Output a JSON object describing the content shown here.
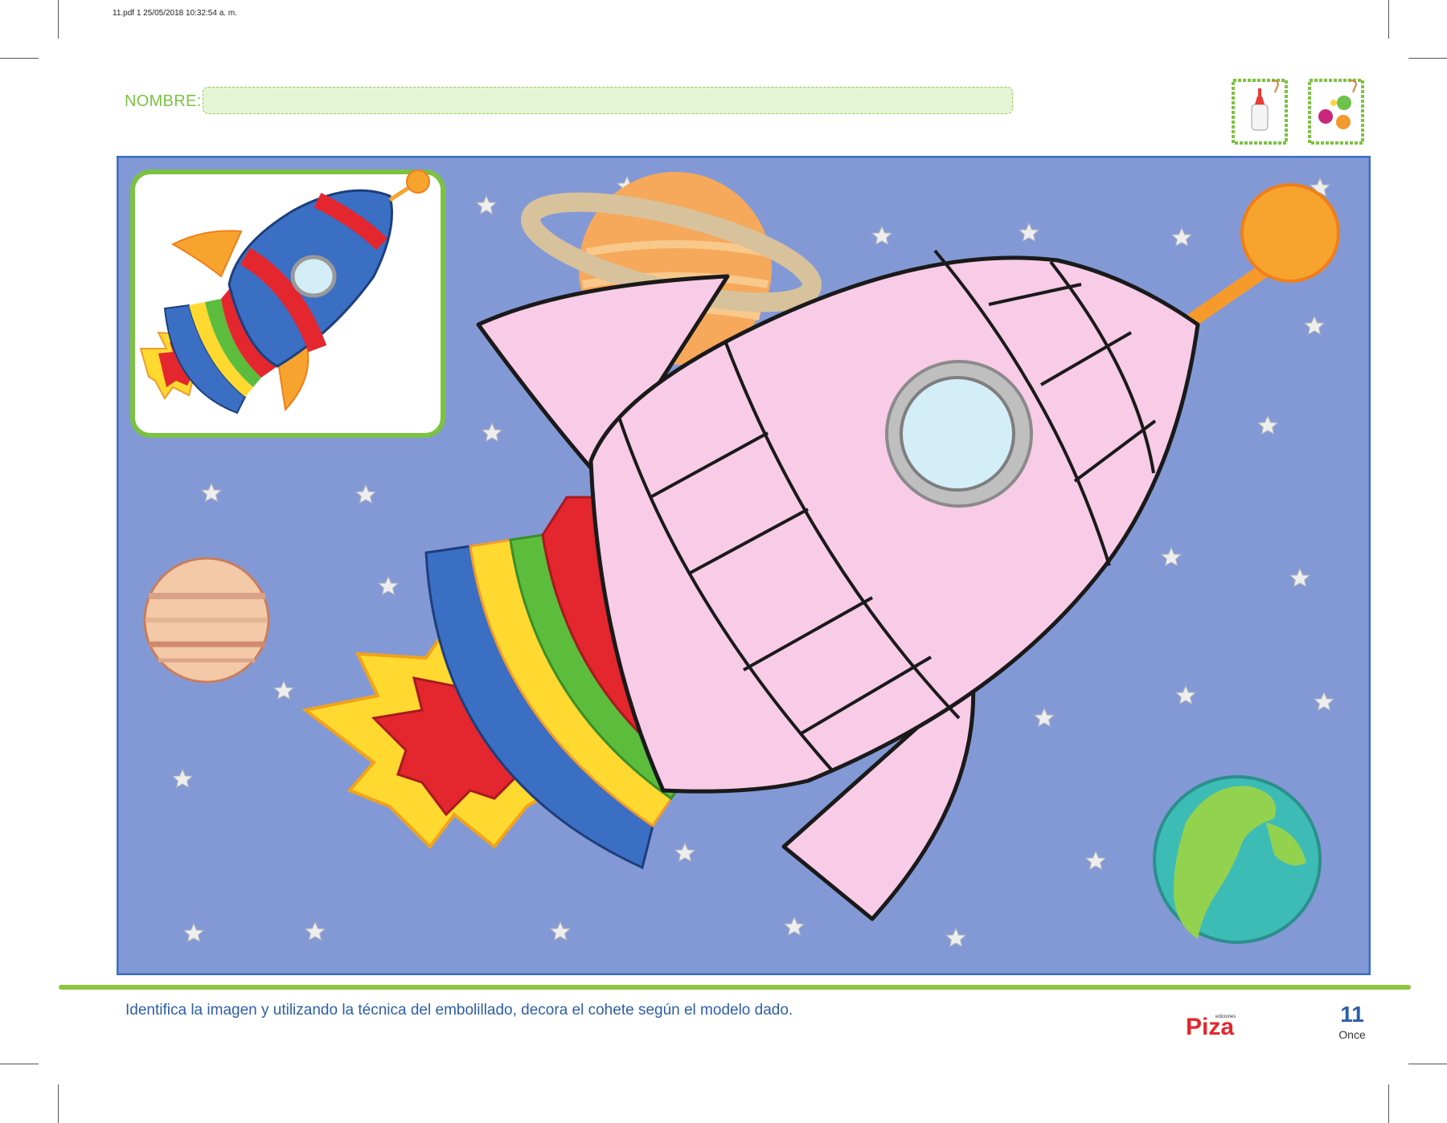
{
  "pdf_header": "11.pdf   1   25/05/2018   10:32:54 a. m.",
  "name_label": "NOMBRE:",
  "name_value": "",
  "materials_icons": [
    "glue-bottle-icon",
    "paper-balls-icon"
  ],
  "illustration": {
    "reference_model": "rocket-model-image",
    "main": "rocket-coloring-image"
  },
  "instruction": "Identifica la imagen y utilizando la técnica del embolillado, decora el cohete según el modelo dado.",
  "brand": {
    "small": "ediciones",
    "name": "Piza"
  },
  "page": {
    "number": "11",
    "word": "Once"
  },
  "colors": {
    "accent_green": "#8cc63f",
    "text_blue": "#2d5ea8",
    "scene_bg": "#8399d6",
    "rocket_pink": "#f8cbe6",
    "brand_red": "#e5262d"
  }
}
